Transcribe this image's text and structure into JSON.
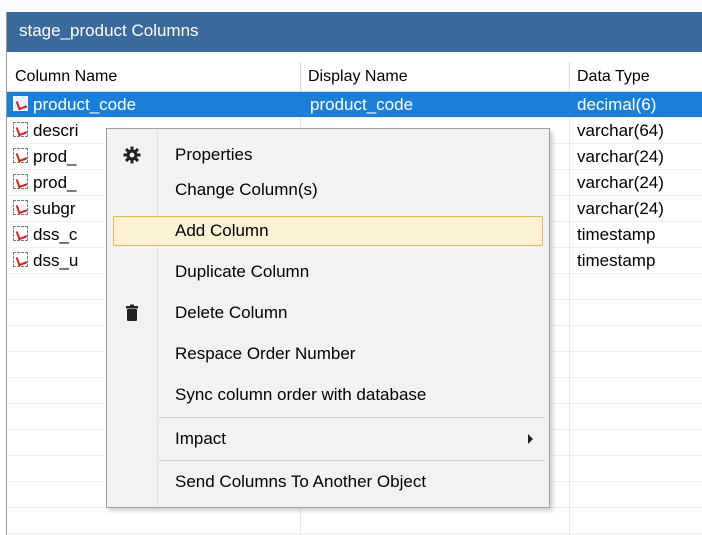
{
  "window": {
    "title": "stage_product Columns"
  },
  "columns": {
    "name_header": "Column Name",
    "display_header": "Display Name",
    "type_header": "Data Type"
  },
  "rows": [
    {
      "name": "product_code",
      "display": "product_code",
      "type": "decimal(6)",
      "selected": true
    },
    {
      "name": "descri",
      "display": "",
      "type": "varchar(64)"
    },
    {
      "name": "prod_",
      "display": "",
      "type": "varchar(24)"
    },
    {
      "name": "prod_",
      "display": "",
      "type": "varchar(24)"
    },
    {
      "name": "subgr",
      "display": "",
      "type": "varchar(24)"
    },
    {
      "name": "dss_c",
      "display": "",
      "type": "timestamp"
    },
    {
      "name": "dss_u",
      "display": "",
      "type": "timestamp"
    }
  ],
  "context_menu": {
    "items": [
      {
        "label": "Properties",
        "icon": "gear-icon"
      },
      {
        "label": "Change Column(s)"
      },
      {
        "label": "Add Column",
        "highlighted": true
      },
      {
        "label": "Duplicate Column"
      },
      {
        "label": "Delete Column",
        "icon": "trash-icon"
      },
      {
        "label": "Respace Order Number"
      },
      {
        "label": "Sync column order with database"
      },
      {
        "label": "Impact",
        "submenu": true
      },
      {
        "label": "Send Columns To Another Object"
      }
    ]
  },
  "colors": {
    "title_bar": "#3a6a9c",
    "selection": "#1a7fd6",
    "highlight": "#fcf1d4",
    "highlight_border": "#e8b75a"
  }
}
